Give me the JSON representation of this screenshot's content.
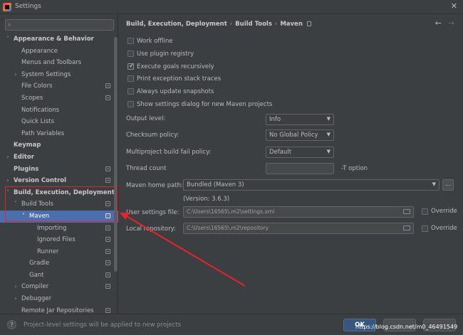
{
  "window": {
    "title": "Settings",
    "close_glyph": "✕"
  },
  "search": {
    "placeholder": "",
    "icon": "search-icon"
  },
  "tree": [
    {
      "label": "Appearance & Behavior",
      "indent": 0,
      "arrow": "˅",
      "bold": true,
      "gear": false
    },
    {
      "label": "Appearance",
      "indent": 1,
      "arrow": "",
      "bold": false,
      "gear": false
    },
    {
      "label": "Menus and Toolbars",
      "indent": 1,
      "arrow": "",
      "bold": false,
      "gear": false
    },
    {
      "label": "System Settings",
      "indent": 1,
      "arrow": "›",
      "bold": false,
      "gear": false
    },
    {
      "label": "File Colors",
      "indent": 1,
      "arrow": "",
      "bold": false,
      "gear": true
    },
    {
      "label": "Scopes",
      "indent": 1,
      "arrow": "",
      "bold": false,
      "gear": true
    },
    {
      "label": "Notifications",
      "indent": 1,
      "arrow": "",
      "bold": false,
      "gear": false
    },
    {
      "label": "Quick Lists",
      "indent": 1,
      "arrow": "",
      "bold": false,
      "gear": false
    },
    {
      "label": "Path Variables",
      "indent": 1,
      "arrow": "",
      "bold": false,
      "gear": false
    },
    {
      "label": "Keymap",
      "indent": 0,
      "arrow": "",
      "bold": true,
      "gear": false
    },
    {
      "label": "Editor",
      "indent": 0,
      "arrow": "›",
      "bold": true,
      "gear": false
    },
    {
      "label": "Plugins",
      "indent": 0,
      "arrow": "",
      "bold": true,
      "gear": true
    },
    {
      "label": "Version Control",
      "indent": 0,
      "arrow": "›",
      "bold": true,
      "gear": true
    },
    {
      "label": "Build, Execution, Deployment",
      "indent": 0,
      "arrow": "˅",
      "bold": true,
      "gear": false
    },
    {
      "label": "Build Tools",
      "indent": 1,
      "arrow": "˅",
      "bold": false,
      "gear": true
    },
    {
      "label": "Maven",
      "indent": 2,
      "arrow": "˅",
      "bold": false,
      "gear": true,
      "selected": true
    },
    {
      "label": "Importing",
      "indent": 3,
      "arrow": "",
      "bold": false,
      "gear": true
    },
    {
      "label": "Ignored Files",
      "indent": 3,
      "arrow": "",
      "bold": false,
      "gear": true
    },
    {
      "label": "Runner",
      "indent": 3,
      "arrow": "",
      "bold": false,
      "gear": true
    },
    {
      "label": "Gradle",
      "indent": 2,
      "arrow": "",
      "bold": false,
      "gear": true
    },
    {
      "label": "Gant",
      "indent": 2,
      "arrow": "",
      "bold": false,
      "gear": true
    },
    {
      "label": "Compiler",
      "indent": 1,
      "arrow": "›",
      "bold": false,
      "gear": true
    },
    {
      "label": "Debugger",
      "indent": 1,
      "arrow": "›",
      "bold": false,
      "gear": false
    },
    {
      "label": "Remote Jar Repositories",
      "indent": 1,
      "arrow": "",
      "bold": false,
      "gear": true
    }
  ],
  "breadcrumb": {
    "items": [
      "Build, Execution, Deployment",
      "Build Tools",
      "Maven"
    ],
    "sep": "›"
  },
  "nav": {
    "back": "←",
    "forward": "→"
  },
  "checkboxes": [
    {
      "label": "Work offline",
      "checked": false
    },
    {
      "label": "Use plugin registry",
      "checked": false
    },
    {
      "label": "Execute goals recursively",
      "checked": true
    },
    {
      "label": "Print exception stack traces",
      "checked": false
    },
    {
      "label": "Always update snapshots",
      "checked": false
    },
    {
      "label": "Show settings dialog for new Maven projects",
      "checked": false
    }
  ],
  "fields": {
    "output_level": {
      "label": "Output level:",
      "value": "Info"
    },
    "checksum_policy": {
      "label": "Checksum policy:",
      "value": "No Global Policy"
    },
    "fail_policy": {
      "label": "Multiproject build fail policy:",
      "value": "Default"
    },
    "thread_count": {
      "label": "Thread count",
      "value": "",
      "hint": "-T option"
    },
    "maven_home": {
      "label": "Maven home path:",
      "value": "Bundled (Maven 3)",
      "version": "(Version: 3.6.3)",
      "browse": "..."
    },
    "user_settings": {
      "label": "User settings file:",
      "value": "C:\\Users\\16565\\.m2\\settings.xml",
      "override": "Override"
    },
    "local_repo": {
      "label": "Local repository:",
      "value": "C:\\Users\\16565\\.m2\\repository",
      "override": "Override"
    }
  },
  "footer": {
    "help": "?",
    "message": "Project-level settings will be applied to new projects",
    "ok": "OK",
    "watermark": "https://blog.csdn.net/m0_46491549"
  },
  "colors": {
    "selection": "#4b6eaf",
    "annotation": "#e5232a",
    "primary_button": "#365880"
  }
}
